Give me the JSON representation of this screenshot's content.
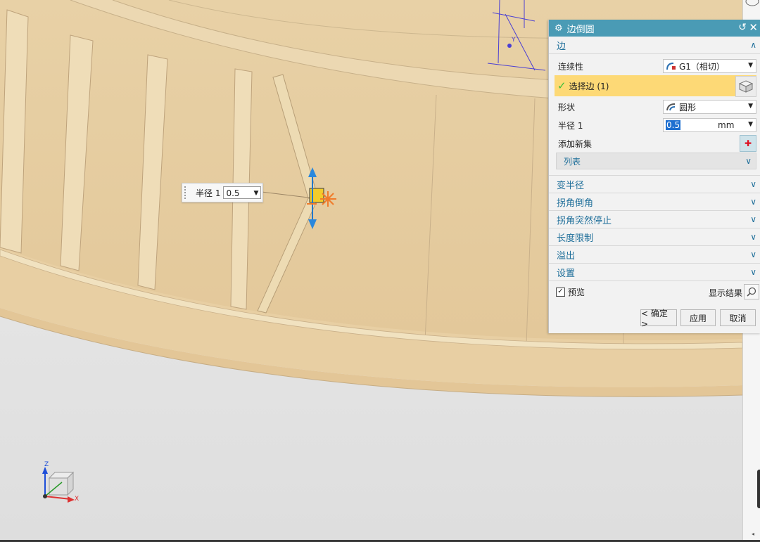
{
  "dialog": {
    "title": "边倒圆",
    "edge_section": {
      "title": "边",
      "continuity_label": "连续性",
      "continuity_value": "G1（相切）",
      "select_edge_label": "选择边 (1)",
      "shape_label": "形状",
      "shape_value": "圆形",
      "radius_label": "半径 1",
      "radius_value": "0.5",
      "radius_unit": "mm",
      "add_new_set_label": "添加新集",
      "list_label": "列表"
    },
    "collapsed_sections": [
      {
        "title": "变半径"
      },
      {
        "title": "拐角倒角"
      },
      {
        "title": "拐角突然停止"
      },
      {
        "title": "长度限制"
      },
      {
        "title": "溢出"
      },
      {
        "title": "设置"
      }
    ],
    "preview_label": "预览",
    "preview_checked": true,
    "show_result_label": "显示结果",
    "ok_label": "< 确定 >",
    "apply_label": "应用",
    "cancel_label": "取消"
  },
  "viewport": {
    "radius_widget_label": "半径 1",
    "radius_widget_value": "0.5",
    "triad_labels": {
      "z": "Z",
      "x": "X",
      "y": "Y"
    }
  },
  "colors": {
    "titlebar": "#4a9bb5",
    "selection_highlight": "#fdd976",
    "part_face": "#e9d3a8",
    "background": "#e6e6e6"
  }
}
